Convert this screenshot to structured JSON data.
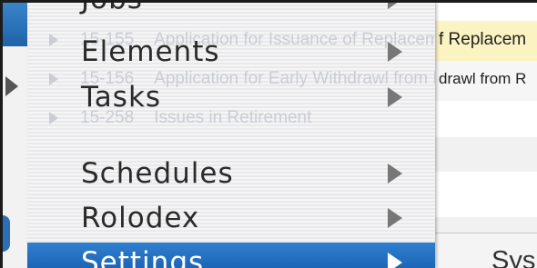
{
  "menu": {
    "items": [
      {
        "label": "Jobs"
      },
      {
        "label": "Elements"
      },
      {
        "label": "Tasks"
      },
      {
        "label": "Schedules"
      },
      {
        "label": "Rolodex"
      },
      {
        "label": "Settings",
        "selected": true
      }
    ],
    "highlight_color": "#1f6fc6"
  },
  "background_list": {
    "rows": [
      {
        "code": "15-155",
        "title": "Application for Issuance of Replacement"
      },
      {
        "code": "15-156",
        "title": "Application for Early Withdrawl from Retirement"
      },
      {
        "code": "15-258",
        "title": "Issues in Retirement"
      }
    ],
    "visible_right_text": [
      "f Replacem",
      "drawl from R"
    ],
    "row_highlight_color": "#fcf3c3"
  },
  "submenu": {
    "first_item": "Sys"
  }
}
